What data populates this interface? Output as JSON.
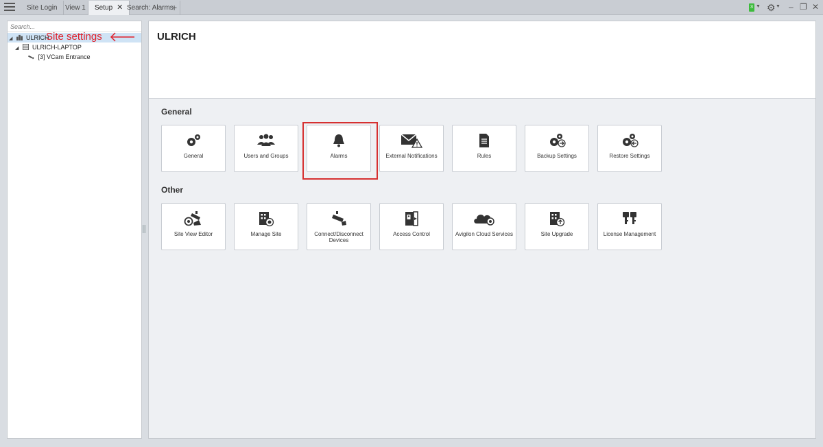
{
  "tabs": [
    {
      "label": "Site Login"
    },
    {
      "label": "View 1"
    },
    {
      "label": "Setup",
      "close": "✕"
    },
    {
      "label": "Search: Alarms"
    }
  ],
  "add_tab": "+",
  "status_count": "3",
  "window": {
    "minimize": "–",
    "restore": "❐",
    "close": "✕"
  },
  "tree": {
    "search_placeholder": "Search...",
    "items": [
      {
        "label": "ULRICH"
      },
      {
        "label": "ULRICH-LAPTOP"
      },
      {
        "label": "[3] VCam Entrance"
      }
    ]
  },
  "annotation": {
    "text": "Site settings",
    "color": "#e0202a"
  },
  "main": {
    "title": "ULRICH",
    "general": {
      "title": "General",
      "items": [
        {
          "label": "General",
          "icon": "gears-icon"
        },
        {
          "label": "Users and Groups",
          "icon": "users-icon"
        },
        {
          "label": "Alarms",
          "icon": "bell-icon"
        },
        {
          "label": "External Notifications",
          "icon": "mail-warning-icon"
        },
        {
          "label": "Rules",
          "icon": "document-icon"
        },
        {
          "label": "Backup Settings",
          "icon": "gears-arrow-icon"
        },
        {
          "label": "Restore Settings",
          "icon": "gears-restore-icon"
        }
      ]
    },
    "other": {
      "title": "Other",
      "items": [
        {
          "label": "Site View Editor",
          "icon": "camera-view-icon"
        },
        {
          "label": "Manage Site",
          "icon": "building-gear-icon"
        },
        {
          "label": "Connect/Disconnect Devices",
          "icon": "camera-connect-icon"
        },
        {
          "label": "Access Control",
          "icon": "door-badge-icon"
        },
        {
          "label": "Avigilon Cloud Services",
          "icon": "cloud-icon"
        },
        {
          "label": "Site Upgrade",
          "icon": "building-upgrade-icon"
        },
        {
          "label": "License Management",
          "icon": "keys-icon"
        }
      ]
    }
  },
  "colors": {
    "accent_highlight": "#d63030",
    "status_green": "#3dbb3d",
    "selection": "#cfe3f5"
  }
}
